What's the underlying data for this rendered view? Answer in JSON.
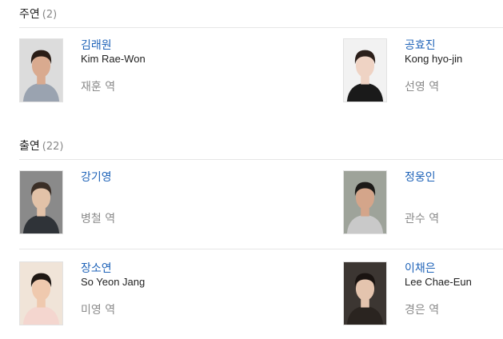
{
  "sections": [
    {
      "title": "주연",
      "count": "(2)",
      "cast": [
        {
          "name": "김래원",
          "name_en": "Kim Rae-Won",
          "role": "재훈 역",
          "photo_colors": {
            "bg": "#dcdcdc",
            "skin": "#d9aa8f",
            "hair": "#2a1d16",
            "cloth": "#9aa3b0"
          }
        },
        {
          "name": "공효진",
          "name_en": "Kong hyo-jin",
          "role": "선영 역",
          "photo_colors": {
            "bg": "#f2f2f2",
            "skin": "#efd3c4",
            "hair": "#2b1f1a",
            "cloth": "#1a1a1a"
          }
        }
      ]
    },
    {
      "title": "출연",
      "count": "(22)",
      "cast": [
        {
          "name": "강기영",
          "name_en": "",
          "role": "병철 역",
          "photo_colors": {
            "bg": "#8a8a8a",
            "skin": "#e2c2a8",
            "hair": "#3a2e26",
            "cloth": "#2f3338"
          }
        },
        {
          "name": "정웅인",
          "name_en": "",
          "role": "관수 역",
          "photo_colors": {
            "bg": "#9ea39a",
            "skin": "#d4a58a",
            "hair": "#1c1a18",
            "cloth": "#c9c9c9"
          }
        },
        {
          "name": "장소연",
          "name_en": "So Yeon Jang",
          "role": "미영 역",
          "photo_colors": {
            "bg": "#f0e4d8",
            "skin": "#efc9ae",
            "hair": "#1f1814",
            "cloth": "#f4d6cf"
          }
        },
        {
          "name": "이채은",
          "name_en": "Lee Chae-Eun",
          "role": "경은 역",
          "photo_colors": {
            "bg": "#3c3632",
            "skin": "#e4c4ae",
            "hair": "#1a1411",
            "cloth": "#2a2420"
          }
        }
      ]
    }
  ]
}
